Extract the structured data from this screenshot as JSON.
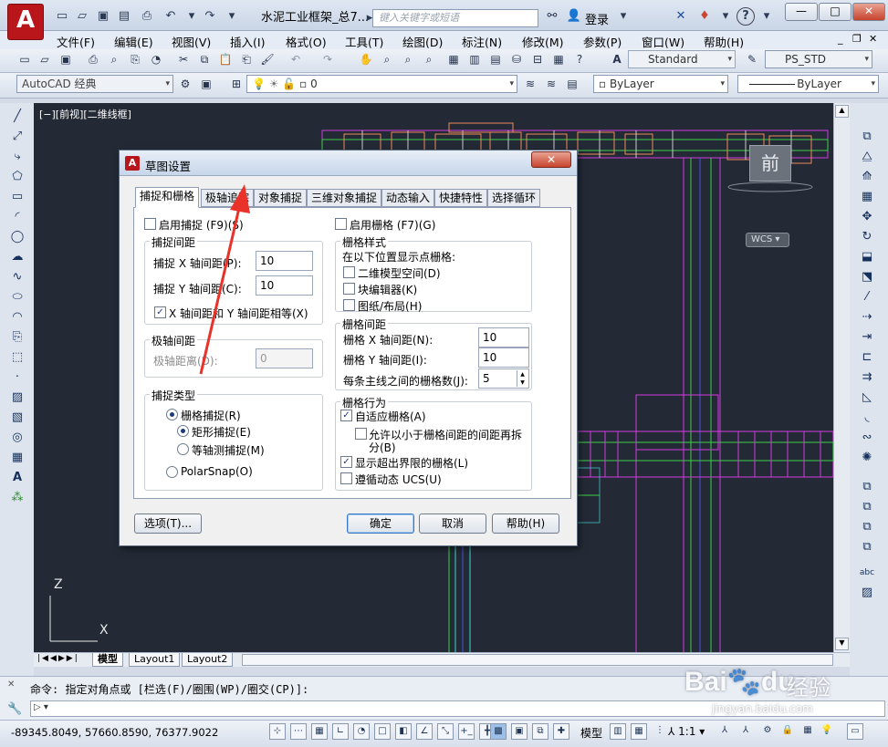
{
  "window": {
    "title": "水泥工业框架_总7...",
    "search_placeholder": "键入关键字或短语",
    "login_label": "登录",
    "help_label": "?",
    "min_label": "—",
    "max_label": "□",
    "close_label": "✕",
    "logo_label": "A"
  },
  "menu": [
    "文件(F)",
    "编辑(E)",
    "视图(V)",
    "插入(I)",
    "格式(O)",
    "工具(T)",
    "绘图(D)",
    "标注(N)",
    "修改(M)",
    "参数(P)",
    "窗口(W)",
    "帮助(H)"
  ],
  "toolbars": {
    "workspace": "AutoCAD 经典",
    "layer_current": "0",
    "text_style": "Standard",
    "plot_style": "PS_STD",
    "color": "ByLayer",
    "linetype": "ByLayer"
  },
  "canvas": {
    "viewport_label": "[−][前视][二维线框]",
    "viewcube_face": "前",
    "wcs_label": "WCS",
    "axis_z": "Z",
    "axis_x": "X"
  },
  "layout_tabs": [
    "模型",
    "Layout1",
    "Layout2"
  ],
  "command": {
    "history": "命令: 指定对角点或 [栏选(F)/圈围(WP)/圈交(CP)]:",
    "input": ""
  },
  "status": {
    "coords": "-89345.8049, 57660.8590, 76377.9022",
    "space": "模型",
    "scale": "1:1"
  },
  "dialog": {
    "title": "草图设置",
    "close_label": "✕",
    "tabs": [
      "捕捉和栅格",
      "极轴追踪",
      "对象捕捉",
      "三维对象捕捉",
      "动态输入",
      "快捷特性",
      "选择循环"
    ],
    "active_tab": 0,
    "snap_on_label": "启用捕捉 (F9)(S)",
    "snap_on": false,
    "snap_spacing_title": "捕捉间距",
    "snap_x_label": "捕捉 X 轴间距(P):",
    "snap_x_value": "10",
    "snap_y_label": "捕捉 Y 轴间距(C):",
    "snap_y_value": "10",
    "equal_xy_label": "X 轴间距和 Y 轴间距相等(X)",
    "equal_xy": true,
    "polar_spacing_title": "极轴间距",
    "polar_distance_label": "极轴距离(D):",
    "polar_distance_value": "0",
    "snap_type_title": "捕捉类型",
    "grid_snap_label": "栅格捕捉(R)",
    "rect_snap_label": "矩形捕捉(E)",
    "iso_snap_label": "等轴测捕捉(M)",
    "polar_snap_label": "PolarSnap(O)",
    "grid_on_label": "启用栅格 (F7)(G)",
    "grid_on": false,
    "grid_style_title": "栅格样式",
    "grid_style_desc": "在以下位置显示点栅格:",
    "grid_2d_label": "二维模型空间(D)",
    "grid_block_label": "块编辑器(K)",
    "grid_paper_label": "图纸/布局(H)",
    "grid_spacing_title": "栅格间距",
    "grid_x_label": "栅格 X 轴间距(N):",
    "grid_x_value": "10",
    "grid_y_label": "栅格 Y 轴间距(I):",
    "grid_y_value": "10",
    "major_label": "每条主线之间的栅格数(J):",
    "major_value": "5",
    "grid_behavior_title": "栅格行为",
    "adaptive_label": "自适应栅格(A)",
    "adaptive": true,
    "subdivide_label_1": "允许以小于栅格间距的间距再拆",
    "subdivide_label_2": "分(B)",
    "subdivide": false,
    "beyond_label": "显示超出界限的栅格(L)",
    "beyond": true,
    "follow_ucs_label": "遵循动态 UCS(U)",
    "follow_ucs": false,
    "options_button": "选项(T)...",
    "ok_button": "确定",
    "cancel_button": "取消",
    "help_button": "帮助(H)"
  },
  "watermark": {
    "brand": "Bai",
    "brand2": "du",
    "brand_cn": "经验",
    "url": "jingyan.baidu.com"
  },
  "colors": {
    "canvas_bg": "#232a35",
    "annotation_arrow": "#e8322a"
  }
}
